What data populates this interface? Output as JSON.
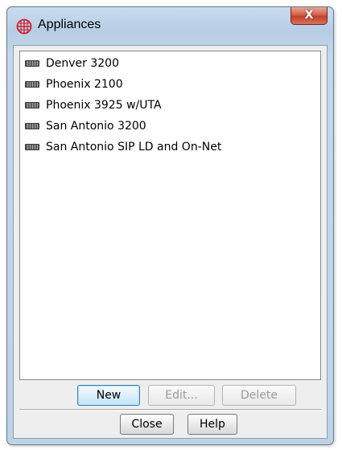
{
  "window": {
    "title": "Appliances",
    "close_label": "X",
    "app_icon": "globe-grid-icon",
    "close_icon": "close-icon"
  },
  "appliances": {
    "item_icon": "appliance-device-icon",
    "items": [
      {
        "label": "Denver 3200"
      },
      {
        "label": "Phoenix 2100"
      },
      {
        "label": "Phoenix 3925 w/UTA"
      },
      {
        "label": "San Antonio 3200"
      },
      {
        "label": "San Antonio SIP LD and On-Net"
      }
    ]
  },
  "actions": {
    "new_label": "New",
    "edit_label": "Edit...",
    "delete_label": "Delete",
    "edit_enabled": false,
    "delete_enabled": false
  },
  "footer": {
    "close_label": "Close",
    "help_label": "Help"
  },
  "colors": {
    "app_icon": "#d0202a",
    "close_button": "#c2412b"
  }
}
